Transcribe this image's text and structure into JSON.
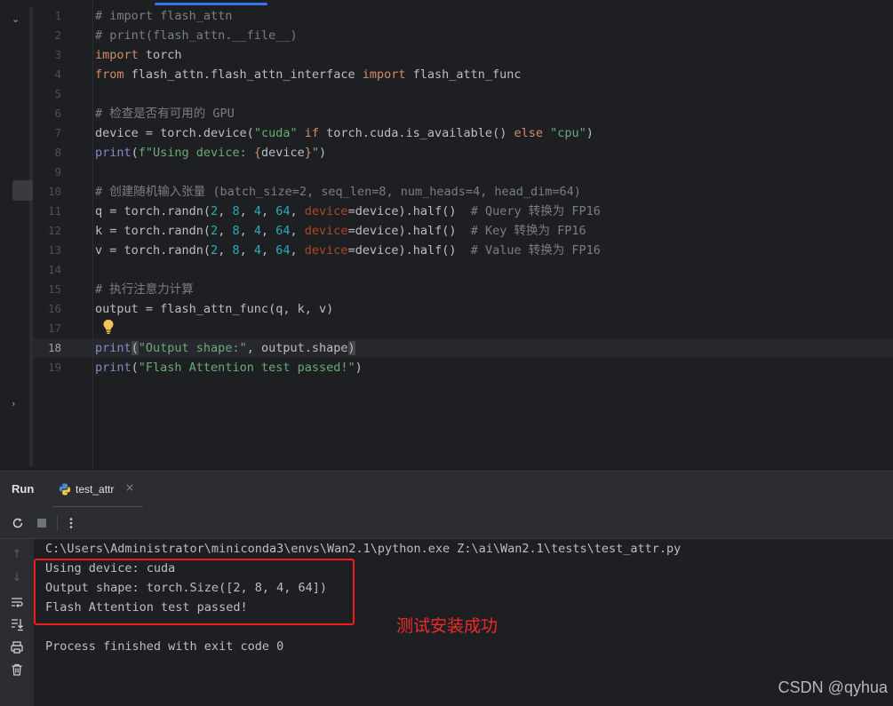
{
  "editor": {
    "line_numbers": [
      "1",
      "2",
      "3",
      "4",
      "5",
      "6",
      "7",
      "8",
      "9",
      "10",
      "11",
      "12",
      "13",
      "14",
      "15",
      "16",
      "17",
      "18",
      "19"
    ],
    "current_line": "18"
  },
  "run_panel": {
    "title": "Run",
    "tab_label": "test_attr",
    "close_glyph": "×"
  },
  "console": {
    "command": "C:\\Users\\Administrator\\miniconda3\\envs\\Wan2.1\\python.exe Z:\\ai\\Wan2.1\\tests\\test_attr.py",
    "output_lines": [
      "Using device: cuda",
      "Output shape: torch.Size([2, 8, 4, 64])",
      "Flash Attention test passed!"
    ],
    "exit_message": "Process finished with exit code 0"
  },
  "annotation": "测试安装成功",
  "watermark": "CSDN @qyhua",
  "icons": {
    "rerun": "rerun-icon",
    "stop": "stop-icon",
    "more": "more-options-icon",
    "scroll_up": "arrow-up-icon",
    "scroll_down": "arrow-down-icon",
    "soft_wrap": "soft-wrap-icon",
    "scroll_end": "scroll-to-end-icon",
    "print": "print-icon",
    "trash": "trash-icon",
    "bulb": "lightbulb-icon",
    "python": "python-file-icon"
  },
  "colors": {
    "background": "#1e1f22",
    "panel": "#2b2d30",
    "keyword": "#cf8e6d",
    "string": "#6aab73",
    "number": "#2aacb8",
    "comment": "#7a7e85",
    "highlight_box": "#f01c1c"
  }
}
